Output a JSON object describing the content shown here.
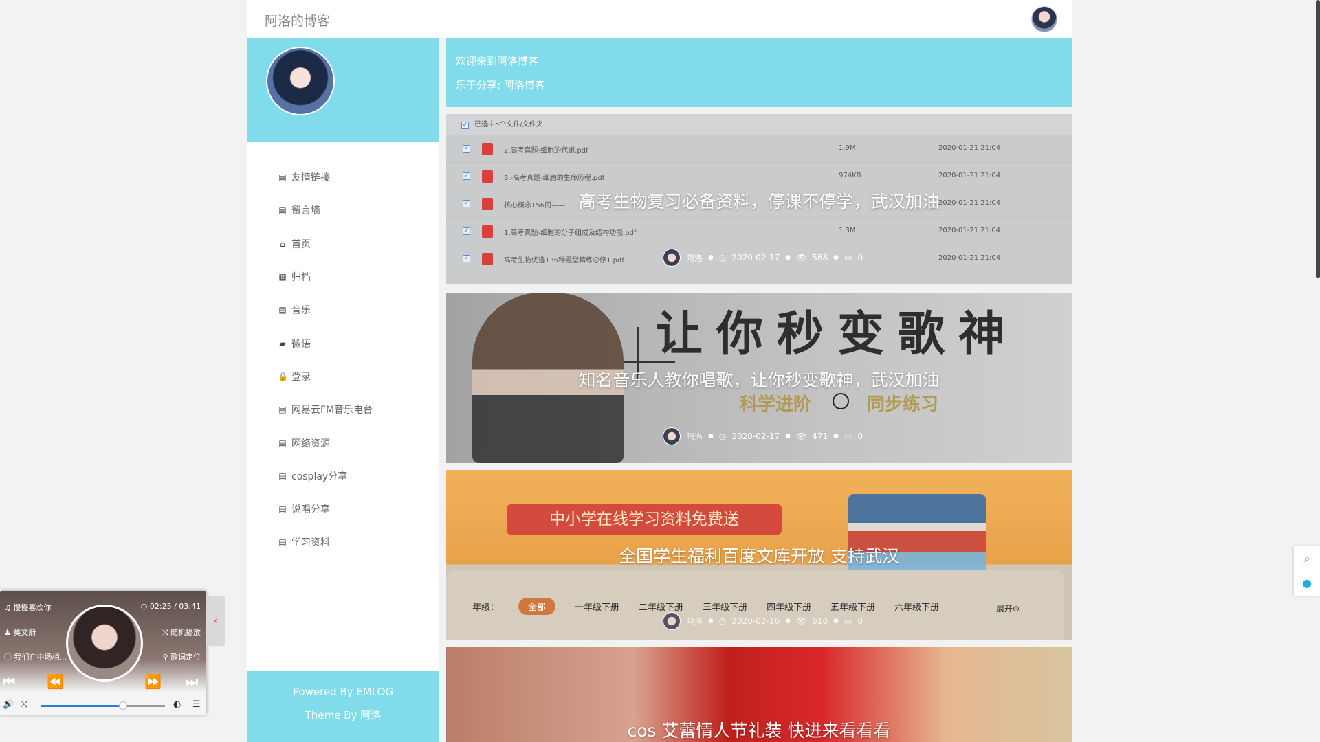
{
  "header": {
    "site_title": "阿洛的博客"
  },
  "sidebar": {
    "nav": [
      {
        "icon": "doc-icon",
        "label": "友情链接"
      },
      {
        "icon": "doc-icon",
        "label": "留言墙"
      },
      {
        "icon": "home-icon",
        "label": "首页"
      },
      {
        "icon": "archive-icon",
        "label": "归档"
      },
      {
        "icon": "doc-icon",
        "label": "音乐"
      },
      {
        "icon": "chat-icon",
        "label": "微语"
      },
      {
        "icon": "lock-icon",
        "label": "登录"
      },
      {
        "icon": "doc-icon",
        "label": "网易云FM音乐电台"
      },
      {
        "icon": "doc-icon",
        "label": "网络资源"
      },
      {
        "icon": "doc-icon",
        "label": "cosplay分享"
      },
      {
        "icon": "doc-icon",
        "label": "说唱分享"
      },
      {
        "icon": "doc-icon",
        "label": "学习资料"
      }
    ],
    "footer": {
      "powered": "Powered By EMLOG",
      "theme": "Theme By 阿洛"
    }
  },
  "welcome": {
    "line1": "欢迎来到阿洛博客",
    "line2": "乐于分享: 阿洛博客"
  },
  "posts": [
    {
      "title": "高考生物复习必备资料，停课不停学，武汉加油",
      "author": "阿洛",
      "date": "2020-02-17",
      "views": "568",
      "comments": "0",
      "image": {
        "header": "已选中5个文件/文件夹",
        "files": [
          {
            "name": "2.高考真题-细胞的代谢.pdf",
            "size": "1.9M",
            "date": "2020-01-21 21:04"
          },
          {
            "name": "3.-高考真题-细胞的生命历程.pdf",
            "size": "974KB",
            "date": "2020-01-21 21:04"
          },
          {
            "name": "核心概念156问——",
            "size": "",
            "date": "2020-01-21 21:04"
          },
          {
            "name": "1.高考真题-细胞的分子组成及结构功能.pdf",
            "size": "1.3M",
            "date": "2020-01-21 21:04"
          },
          {
            "name": "高考生物优选136种题型精练必修1.pdf",
            "size": "",
            "date": "2020-01-21 21:04"
          }
        ]
      }
    },
    {
      "title": "知名音乐人教你唱歌，让你秒变歌神，武汉加油",
      "author": "阿洛",
      "date": "2020-02-17",
      "views": "471",
      "comments": "0",
      "image": {
        "headline": "让你秒变歌神",
        "sub1": "科学进阶",
        "sub2": "同步练习"
      }
    },
    {
      "title": "全国学生福利百度文库开放 支持武汉",
      "author": "阿洛",
      "date": "2020-02-16",
      "views": "610",
      "comments": "0",
      "image": {
        "banner": "中小学在线学习资料免费送",
        "grade_label": "年级：",
        "grades": [
          "全部",
          "一年级下册",
          "二年级下册",
          "三年级下册",
          "四年级下册",
          "五年级下册",
          "六年级下册"
        ],
        "expand": "展开"
      }
    },
    {
      "title": "cos 艾蕾情人节礼装 快进来看看看"
    }
  ],
  "player": {
    "song": "慢慢喜欢你",
    "artist": "莫文蔚",
    "lyric": "我们在中场相...",
    "time": "02:25 / 03:41",
    "mode": "随机播放",
    "lyric_locate": "歌词定位",
    "progress": 0.66
  }
}
